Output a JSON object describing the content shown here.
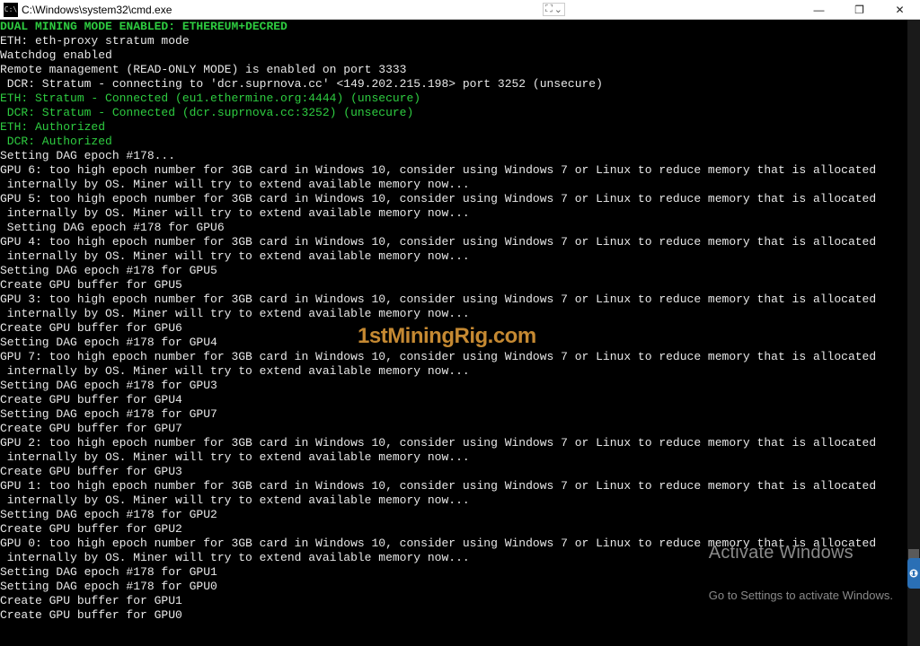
{
  "title": "C:\\Windows\\system32\\cmd.exe",
  "title_icon_text": "C:\\",
  "mid_icon1": "⛶",
  "mid_icon2": "⌄",
  "btn": {
    "min": "—",
    "max": "❐",
    "close": "✕"
  },
  "lines": [
    {
      "cls": "c-green-b",
      "t": "DUAL MINING MODE ENABLED: ETHEREUM+DECRED"
    },
    {
      "cls": "c-white",
      "t": "ETH: eth-proxy stratum mode"
    },
    {
      "cls": "c-white",
      "t": "Watchdog enabled"
    },
    {
      "cls": "c-white",
      "t": "Remote management (READ-ONLY MODE) is enabled on port 3333"
    },
    {
      "cls": "c-white",
      "t": " DCR: Stratum - connecting to 'dcr.suprnova.cc' <149.202.215.198> port 3252 (unsecure)"
    },
    {
      "cls": "c-white",
      "t": ""
    },
    {
      "cls": "c-green",
      "t": "ETH: Stratum - Connected (eu1.ethermine.org:4444) (unsecure)"
    },
    {
      "cls": "c-green",
      "t": " DCR: Stratum - Connected (dcr.suprnova.cc:3252) (unsecure)"
    },
    {
      "cls": "c-green",
      "t": "ETH: Authorized"
    },
    {
      "cls": "c-green",
      "t": " DCR: Authorized"
    },
    {
      "cls": "c-white",
      "t": "Setting DAG epoch #178..."
    },
    {
      "cls": "c-white",
      "t": "GPU 6: too high epoch number for 3GB card in Windows 10, consider using Windows 7 or Linux to reduce memory that is allocated\n internally by OS. Miner will try to extend available memory now..."
    },
    {
      "cls": "c-white",
      "t": "GPU 5: too high epoch number for 3GB card in Windows 10, consider using Windows 7 or Linux to reduce memory that is allocated\n internally by OS. Miner will try to extend available memory now..."
    },
    {
      "cls": "c-white",
      "t": " Setting DAG epoch #178 for GPU6"
    },
    {
      "cls": "c-white",
      "t": "GPU 4: too high epoch number for 3GB card in Windows 10, consider using Windows 7 or Linux to reduce memory that is allocated\n internally by OS. Miner will try to extend available memory now..."
    },
    {
      "cls": "c-white",
      "t": "Setting DAG epoch #178 for GPU5"
    },
    {
      "cls": "c-white",
      "t": "Create GPU buffer for GPU5"
    },
    {
      "cls": "c-white",
      "t": "GPU 3: too high epoch number for 3GB card in Windows 10, consider using Windows 7 or Linux to reduce memory that is allocated\n internally by OS. Miner will try to extend available memory now..."
    },
    {
      "cls": "c-white",
      "t": "Create GPU buffer for GPU6"
    },
    {
      "cls": "c-white",
      "t": "Setting DAG epoch #178 for GPU4"
    },
    {
      "cls": "c-white",
      "t": "GPU 7: too high epoch number for 3GB card in Windows 10, consider using Windows 7 or Linux to reduce memory that is allocated\n internally by OS. Miner will try to extend available memory now..."
    },
    {
      "cls": "c-white",
      "t": "Setting DAG epoch #178 for GPU3"
    },
    {
      "cls": "c-white",
      "t": "Create GPU buffer for GPU4"
    },
    {
      "cls": "c-white",
      "t": "Setting DAG epoch #178 for GPU7"
    },
    {
      "cls": "c-white",
      "t": "Create GPU buffer for GPU7"
    },
    {
      "cls": "c-white",
      "t": "GPU 2: too high epoch number for 3GB card in Windows 10, consider using Windows 7 or Linux to reduce memory that is allocated\n internally by OS. Miner will try to extend available memory now..."
    },
    {
      "cls": "c-white",
      "t": "Create GPU buffer for GPU3"
    },
    {
      "cls": "c-white",
      "t": "GPU 1: too high epoch number for 3GB card in Windows 10, consider using Windows 7 or Linux to reduce memory that is allocated\n internally by OS. Miner will try to extend available memory now..."
    },
    {
      "cls": "c-white",
      "t": "Setting DAG epoch #178 for GPU2"
    },
    {
      "cls": "c-white",
      "t": "Create GPU buffer for GPU2"
    },
    {
      "cls": "c-white",
      "t": "GPU 0: too high epoch number for 3GB card in Windows 10, consider using Windows 7 or Linux to reduce memory that is allocated\n internally by OS. Miner will try to extend available memory now..."
    },
    {
      "cls": "c-white",
      "t": "Setting DAG epoch #178 for GPU1"
    },
    {
      "cls": "c-white",
      "t": "Setting DAG epoch #178 for GPU0"
    },
    {
      "cls": "c-white",
      "t": "Create GPU buffer for GPU1"
    },
    {
      "cls": "c-white",
      "t": "Create GPU buffer for GPU0"
    }
  ],
  "overlay": "1stMiningRig.com",
  "activate": {
    "h": "Activate Windows",
    "s": "Go to Settings to activate Windows."
  }
}
